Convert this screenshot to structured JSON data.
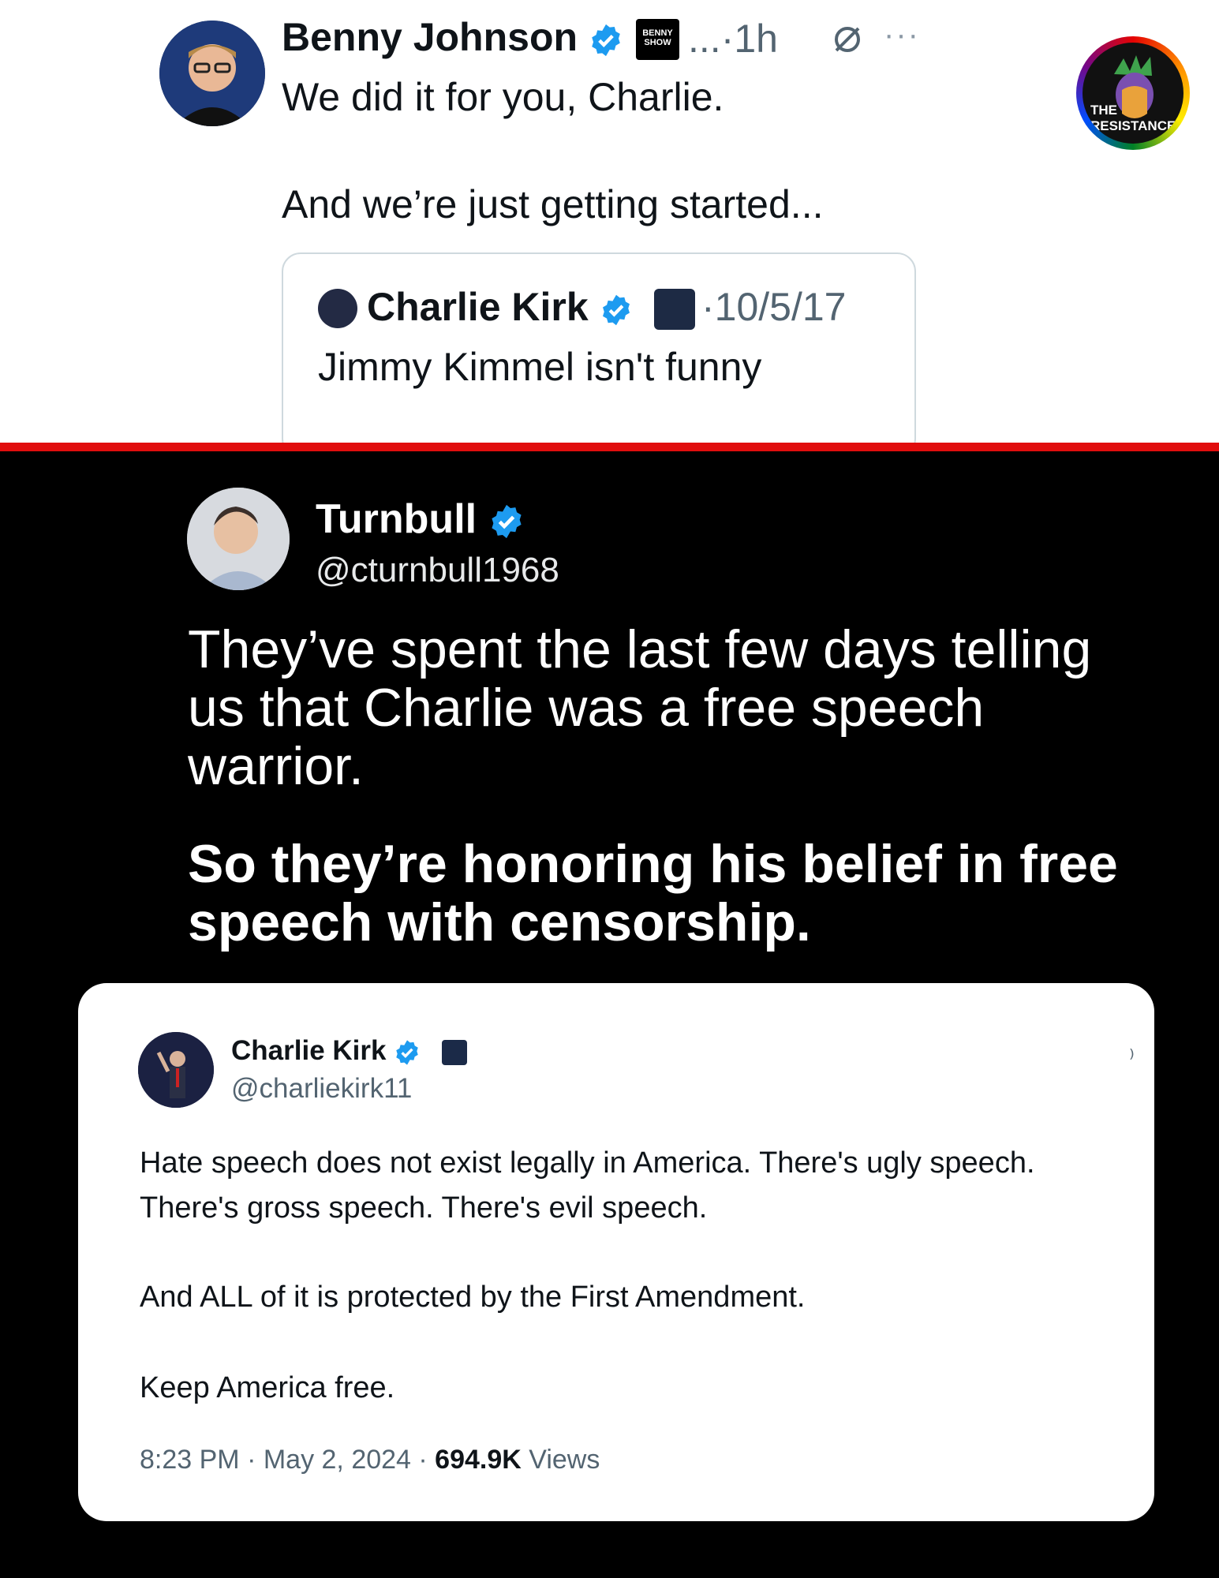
{
  "top_tweet": {
    "author": "Benny Johnson",
    "badge_text": "BENNY SHOW",
    "dots": "...",
    "time": "·1h",
    "more": "···",
    "line1": "We did it for you, Charlie.",
    "line2": "And we’re just getting started...",
    "quote": {
      "author": "Charlie Kirk",
      "date": "·10/5/17",
      "text": "Jimmy Kimmel isn't funny"
    }
  },
  "logo": {
    "text_line1": "THE",
    "text_line2": "RESISTANCE"
  },
  "turnbull": {
    "name": "Turnbull",
    "handle": "@cturnbull1968",
    "body": "They’ve spent the last few days telling us that Charlie was a free speech warrior.",
    "bold": "So they’re honoring his belief in free speech with censorship."
  },
  "ck_tweet": {
    "name": "Charlie Kirk",
    "handle": "@charliekirk11",
    "para1_line1": "Hate speech does not exist legally in America. There's ugly speech.",
    "para1_line2": "There's gross speech. There's evil speech.",
    "para2": "And ALL of it is protected by the First Amendment.",
    "para3": "Keep America free.",
    "time": "8:23 PM · May 2, 2024 · ",
    "views_count": "694.9K",
    "views_label": " Views"
  },
  "colors": {
    "verified": "#1d9bf0",
    "divider": "#e10d0d",
    "dark_bg": "#000000"
  }
}
